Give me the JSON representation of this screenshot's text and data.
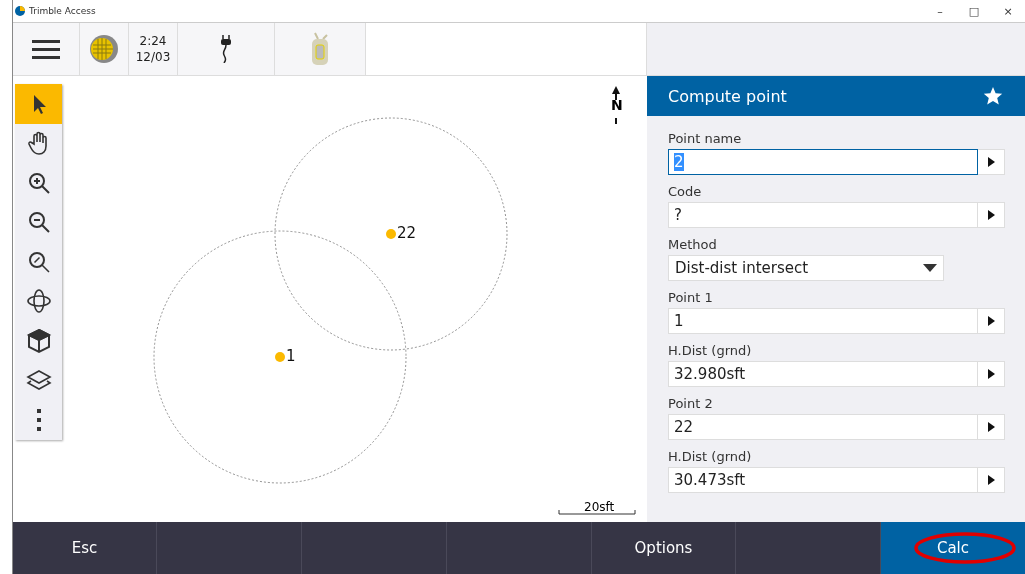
{
  "window": {
    "title": "Trimble Access",
    "controls": [
      "–",
      "□",
      "×"
    ]
  },
  "status_bar": {
    "time": "2:24",
    "date": "12/03"
  },
  "map_tools": [
    {
      "kind": "select",
      "selected": true
    },
    {
      "kind": "pan",
      "selected": false
    },
    {
      "kind": "zoom-in",
      "selected": false
    },
    {
      "kind": "zoom-out",
      "selected": false
    },
    {
      "kind": "zoom-extents",
      "selected": false
    },
    {
      "kind": "orbit",
      "selected": false
    },
    {
      "kind": "view",
      "selected": false
    },
    {
      "kind": "layers",
      "selected": false
    },
    {
      "kind": "more",
      "selected": false
    }
  ],
  "map": {
    "north": "N",
    "scale": "20sft",
    "points": [
      {
        "label": "1"
      },
      {
        "label": "22"
      }
    ]
  },
  "panel": {
    "title": "Compute point",
    "fields": [
      {
        "kind": "input",
        "label": "Point name",
        "value": "2",
        "text_selected": true
      },
      {
        "kind": "input",
        "label": "Code",
        "value": "?",
        "text_selected": false
      },
      {
        "kind": "dropdown",
        "label": "Method",
        "value": "Dist-dist intersect"
      },
      {
        "kind": "input",
        "label": "Point 1",
        "value": "1",
        "text_selected": false
      },
      {
        "kind": "input",
        "label": "H.Dist (grnd)",
        "value": "32.980sft",
        "text_selected": false
      },
      {
        "kind": "input",
        "label": "Point 2",
        "value": "22",
        "text_selected": false
      },
      {
        "kind": "input",
        "label": "H.Dist (grnd)",
        "value": "30.473sft",
        "text_selected": false
      }
    ]
  },
  "softkeys": [
    {
      "kind": "key",
      "label": "Esc"
    },
    {
      "kind": "empty"
    },
    {
      "kind": "empty"
    },
    {
      "kind": "empty"
    },
    {
      "kind": "key",
      "label": "Options"
    },
    {
      "kind": "empty"
    },
    {
      "kind": "primary",
      "label": "Calc",
      "circled": true
    }
  ]
}
